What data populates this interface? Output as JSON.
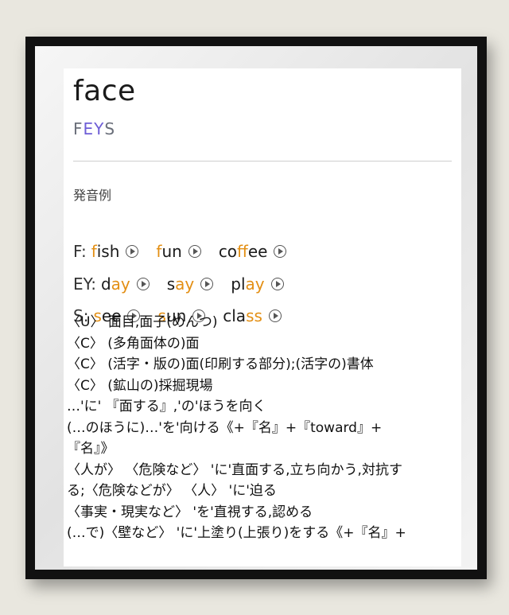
{
  "entry": {
    "word": "face",
    "pronunciation": [
      {
        "text": "F",
        "highlight": false
      },
      {
        "text": "EY",
        "highlight": true
      },
      {
        "text": "S",
        "highlight": false
      }
    ]
  },
  "examples": {
    "title": "発音例",
    "rows": [
      {
        "label": "F:",
        "words": [
          [
            {
              "t": "",
              "o": false
            },
            {
              "t": "f",
              "o": true
            },
            {
              "t": "ish",
              "o": false
            }
          ],
          [
            {
              "t": "f",
              "o": true
            },
            {
              "t": "un",
              "o": false
            }
          ],
          [
            {
              "t": "co",
              "o": false
            },
            {
              "t": "ff",
              "o": true
            },
            {
              "t": "ee",
              "o": false
            }
          ]
        ]
      },
      {
        "label": "EY:",
        "words": [
          [
            {
              "t": "d",
              "o": false
            },
            {
              "t": "ay",
              "o": true
            }
          ],
          [
            {
              "t": "s",
              "o": false
            },
            {
              "t": "ay",
              "o": true
            }
          ],
          [
            {
              "t": "pl",
              "o": false
            },
            {
              "t": "ay",
              "o": true
            }
          ]
        ]
      },
      {
        "label": "S:",
        "words": [
          [
            {
              "t": "s",
              "o": true
            },
            {
              "t": "ee",
              "o": false
            }
          ],
          [
            {
              "t": "s",
              "o": true
            },
            {
              "t": "un",
              "o": false
            }
          ],
          [
            {
              "t": "cla",
              "o": false
            },
            {
              "t": "ss",
              "o": true
            }
          ]
        ]
      }
    ]
  },
  "definitions": [
    " 〈U〉 面目,面子(めんつ)",
    " 〈C〉 (多角面体の)面",
    " 〈C〉 (活字・版の)面(印刷する部分);(活字の)書体",
    " 〈C〉 (鉱山の)採掘現場",
    "…'に' 『面する』,'の'ほうを向く",
    "(…のほうに)…'を'向ける《+『名』+『toward』+",
    "『名』》",
    " 〈人が〉 〈危険など〉 'に'直面する,立ち向かう,対抗す",
    "る;〈危険などが〉 〈人〉 'に'迫る",
    " 〈事実・現実など〉 'を'直視する,認める",
    "(…で)〈壁など〉 'に'上塗り(上張り)をする《+『名』+"
  ],
  "colors": {
    "highlight_vowel": "#6e5ed6",
    "example_accent": "#e38f14"
  }
}
